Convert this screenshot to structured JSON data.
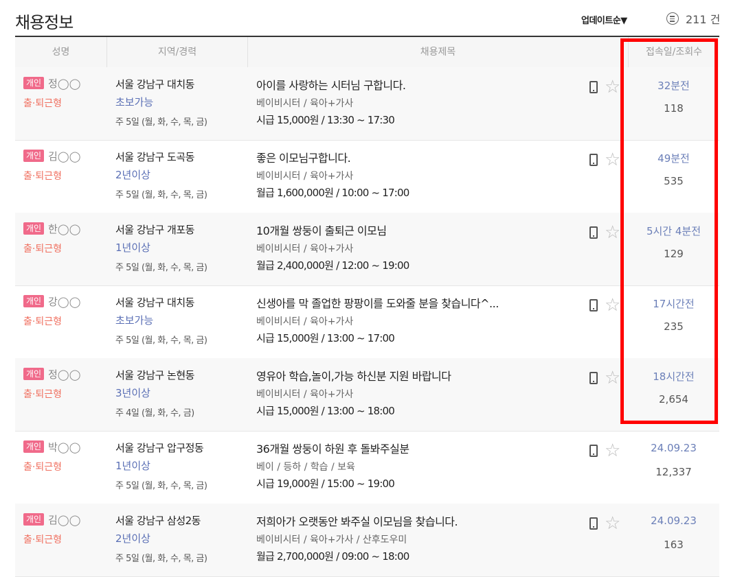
{
  "header": {
    "title": "채용정보",
    "sort_label": "업데이트순▼",
    "count_label": "211 건"
  },
  "columns": [
    "성명",
    "지역/경력",
    "채용제목",
    "접속일/조회수"
  ],
  "rows": [
    {
      "badge": "개인",
      "name": "정◯◯",
      "worktype": "출·퇴근형",
      "region": "서울 강남구 대치동",
      "exp": "초보가능",
      "days": "주 5일 (월, 화, 수, 목, 금)",
      "title": "아이를 사랑하는 시터님 구합니다.",
      "category": "베이비시터 / 육아+가사",
      "pay": "시급 15,000원 / 13:30 ~ 17:30",
      "ago": "32분전",
      "views": "118"
    },
    {
      "badge": "개인",
      "name": "김◯◯",
      "worktype": "출·퇴근형",
      "region": "서울 강남구 도곡동",
      "exp": "2년이상",
      "days": "주 5일 (월, 화, 수, 목, 금)",
      "title": "좋은 이모님구합니다.",
      "category": "베이비시터 / 육아+가사",
      "pay": "월급 1,600,000원 / 10:00 ~ 17:00",
      "ago": "49분전",
      "views": "535"
    },
    {
      "badge": "개인",
      "name": "한◯◯",
      "worktype": "출·퇴근형",
      "region": "서울 강남구 개포동",
      "exp": "1년이상",
      "days": "주 5일 (월, 화, 수, 목, 금)",
      "title": "10개월 쌍둥이 출퇴근 이모님",
      "category": "베이비시터 / 육아+가사",
      "pay": "월급 2,400,000원 / 12:00 ~ 19:00",
      "ago": "5시간 4분전",
      "views": "129"
    },
    {
      "badge": "개인",
      "name": "강◯◯",
      "worktype": "출·퇴근형",
      "region": "서울 강남구 대치동",
      "exp": "초보가능",
      "days": "주 5일 (월, 화, 수, 목, 금)",
      "title": "신생아를 막 졸업한 팡팡이를 도와줄 분을 찾습니다^...",
      "category": "베이비시터 / 육아+가사",
      "pay": "시급 15,000원 / 13:00 ~ 17:00",
      "ago": "17시간전",
      "views": "235"
    },
    {
      "badge": "개인",
      "name": "정◯◯",
      "worktype": "출·퇴근형",
      "region": "서울 강남구 논현동",
      "exp": "3년이상",
      "days": "주 4일 (월, 화, 수, 금)",
      "title": "영유아 학습,놀이,가능 하신분 지원 바랍니다",
      "category": "베이비시터 / 육아+가사",
      "pay": "시급 15,000원 / 13:00 ~ 18:00",
      "ago": "18시간전",
      "views": "2,654"
    },
    {
      "badge": "개인",
      "name": "박◯◯",
      "worktype": "출·퇴근형",
      "region": "서울 강남구 압구정동",
      "exp": "1년이상",
      "days": "주 5일 (월, 화, 수, 목, 금)",
      "title": "36개월 쌍둥이 하원 후 돌봐주실분",
      "category": "베이 / 등하 / 학습 / 보육",
      "pay": "시급 19,000원 / 15:00 ~ 19:00",
      "ago": "24.09.23",
      "views": "12,337"
    },
    {
      "badge": "개인",
      "name": "김◯◯",
      "worktype": "출·퇴근형",
      "region": "서울 강남구 삼성2동",
      "exp": "2년이상",
      "days": "주 5일 (월, 화, 수, 목, 금)",
      "title": "저희아가 오랫동안 봐주실 이모님을 찾습니다.",
      "category": "베이비시터 / 육아+가사 / 산후도우미",
      "pay": "월급 2,700,000원 / 09:00 ~ 18:00",
      "ago": "24.09.23",
      "views": "163"
    }
  ]
}
